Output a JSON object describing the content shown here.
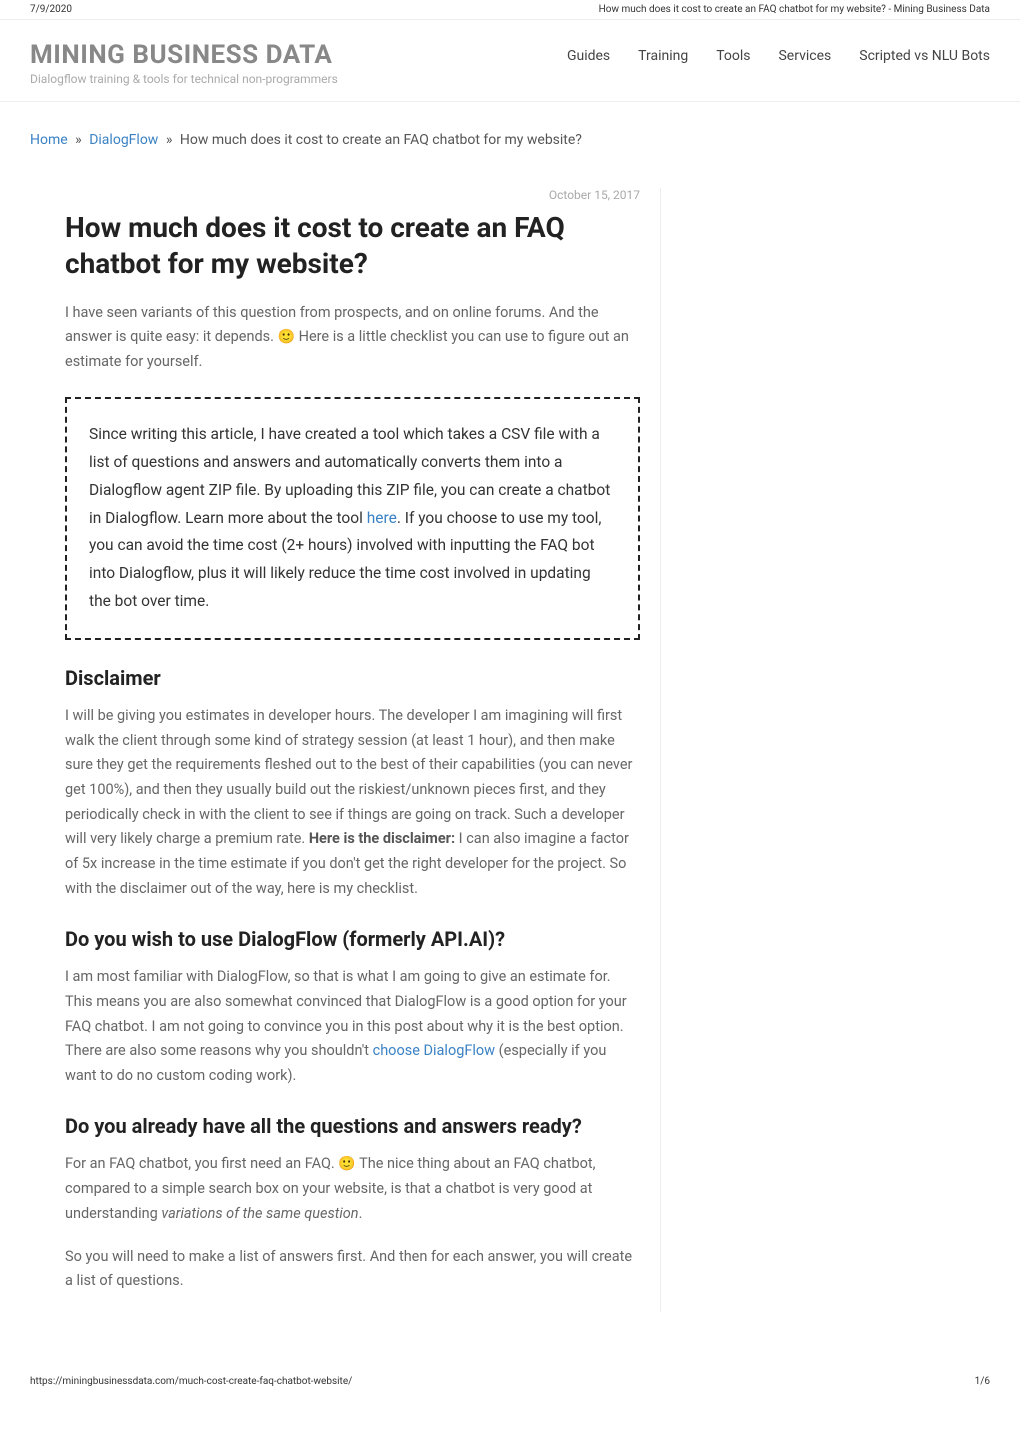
{
  "print_header": {
    "date": "7/9/2020",
    "title": "How much does it cost to create an FAQ chatbot for my website? - Mining Business Data"
  },
  "header": {
    "brand_title": "MINING BUSINESS DATA",
    "brand_tagline": "Dialogflow training & tools for technical non-programmers",
    "nav": [
      {
        "label": "Guides"
      },
      {
        "label": "Training"
      },
      {
        "label": "Tools"
      },
      {
        "label": "Services"
      },
      {
        "label": "Scripted vs NLU Bots"
      }
    ]
  },
  "breadcrumb": {
    "home": "Home",
    "category": "DialogFlow",
    "current": "How much does it cost to create an FAQ chatbot for my website?",
    "sep": "»"
  },
  "post": {
    "date": "October 15, 2017",
    "title": "How much does it cost to create an FAQ chatbot for my website?",
    "intro_before_emoji": "I have seen variants of this question from prospects, and on online forums. And the answer is quite easy: it depends. ",
    "intro_after_emoji": " Here is a little checklist you can use to figure out an estimate for yourself.",
    "callout_before_link": "Since writing this article, I have created a tool which takes a CSV file with a list of questions and answers and automatically converts them into a Dialogflow agent ZIP file. By uploading this ZIP file, you can create a chatbot in Dialogflow. Learn more about the tool ",
    "callout_link": "here",
    "callout_after_link": ". If you choose to use my tool, you can avoid the time cost (2+ hours) involved with inputting the FAQ bot into Dialogflow, plus it will likely reduce the time cost involved in updating the bot over time.",
    "sections": {
      "disclaimer": {
        "heading": "Disclaimer",
        "body_before_strong": "I will be giving you estimates in developer hours. The developer I am imagining will first walk the client through some kind of strategy session (at least 1 hour), and then make sure they get the requirements fleshed out to the best of their capabilities (you can never get 100%), and then they usually build out the riskiest/unknown pieces first, and they periodically check in with the client to see if things are going on track. Such a developer will very likely charge a premium rate. ",
        "body_strong": "Here is the disclaimer:",
        "body_after_strong": " I can also imagine a factor of 5x increase in the time estimate if you don't get the right developer for the project. So with the disclaimer out of the way, here is my checklist."
      },
      "dialogflow": {
        "heading": "Do you wish to use DialogFlow (formerly API.AI)?",
        "body_before_link": "I am most familiar with DialogFlow, so that is what I am going to give an estimate for. This means you are also somewhat convinced that DialogFlow is a good option for your FAQ chatbot. I am not going to convince you in this post about why it is the best option. There are also some reasons why you shouldn't ",
        "body_link": "choose DialogFlow",
        "body_after_link": " (especially if you want to do no custom coding work)."
      },
      "questions_ready": {
        "heading": "Do you already have all the questions and answers ready?",
        "body_before_emoji": "For an FAQ chatbot, you first need an FAQ. ",
        "body_after_emoji": " The nice thing about an FAQ chatbot, compared to a simple search box on your website, is that a chatbot is very good at understanding ",
        "body_italic": "variations of the same question",
        "body_after_italic": ".",
        "body2": "So you will need to make a list of answers first. And then for each answer, you will create a list of questions."
      }
    }
  },
  "print_footer": {
    "url": "https://miningbusinessdata.com/much-cost-create-faq-chatbot-website/",
    "page": "1/6"
  }
}
